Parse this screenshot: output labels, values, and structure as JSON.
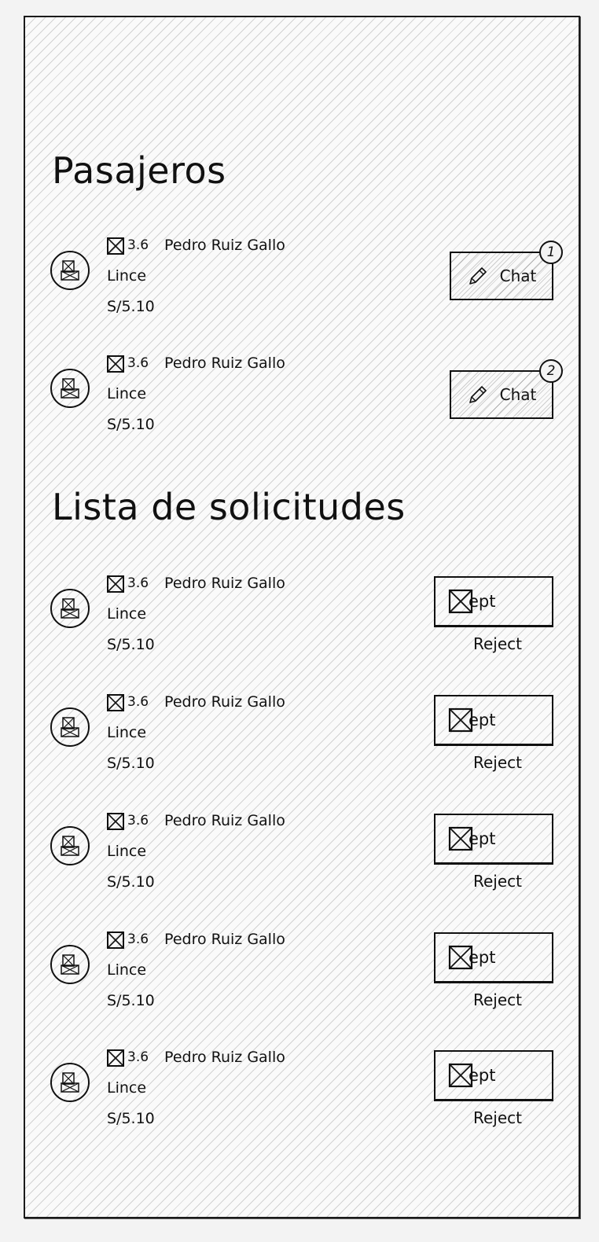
{
  "passengers_section": {
    "title": "Pasajeros",
    "items": [
      {
        "rating": "3.6",
        "name": "Pedro Ruiz Gallo",
        "district": "Lince",
        "price": "S/5.10",
        "chat_label": "Chat",
        "badge": "1"
      },
      {
        "rating": "3.6",
        "name": "Pedro Ruiz Gallo",
        "district": "Lince",
        "price": "S/5.10",
        "chat_label": "Chat",
        "badge": "2"
      }
    ]
  },
  "requests_section": {
    "title": "Lista de solicitudes",
    "items": [
      {
        "rating": "3.6",
        "name": "Pedro Ruiz Gallo",
        "district": "Lince",
        "price": "S/5.10",
        "accept_label": "ept",
        "reject_label": "Reject"
      },
      {
        "rating": "3.6",
        "name": "Pedro Ruiz Gallo",
        "district": "Lince",
        "price": "S/5.10",
        "accept_label": "ept",
        "reject_label": "Reject"
      },
      {
        "rating": "3.6",
        "name": "Pedro Ruiz Gallo",
        "district": "Lince",
        "price": "S/5.10",
        "accept_label": "ept",
        "reject_label": "Reject"
      },
      {
        "rating": "3.6",
        "name": "Pedro Ruiz Gallo",
        "district": "Lince",
        "price": "S/5.10",
        "accept_label": "ept",
        "reject_label": "Reject"
      },
      {
        "rating": "3.6",
        "name": "Pedro Ruiz Gallo",
        "district": "Lince",
        "price": "S/5.10",
        "accept_label": "ept",
        "reject_label": "Reject"
      }
    ]
  },
  "icons": {
    "avatar": "avatar-placeholder-icon",
    "image_placeholder": "image-placeholder-icon",
    "chat_button": "pencil-icon"
  }
}
